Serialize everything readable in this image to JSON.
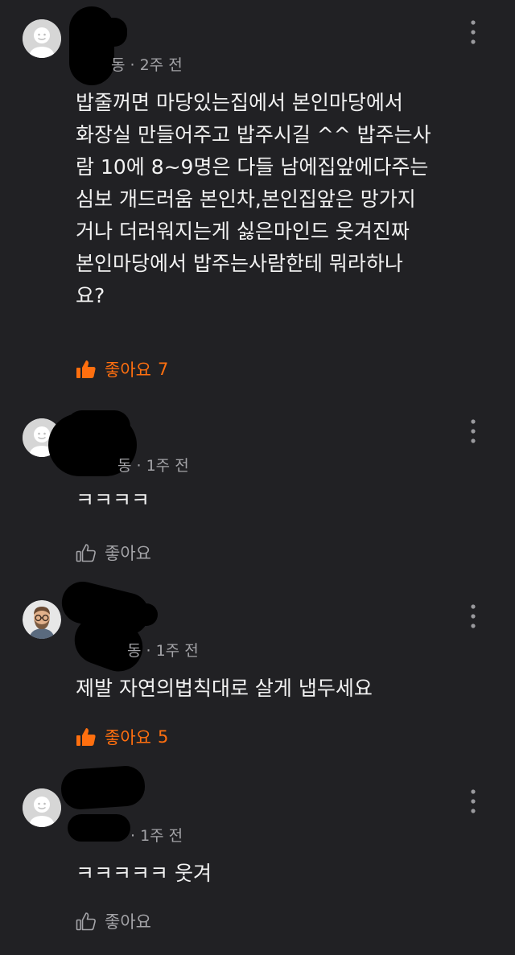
{
  "comments": [
    {
      "meta_tail": "동 · 2주 전",
      "text": "밥줄꺼면 마당있는집에서 본인마당에서\n화장실 만들어주고 밥주시길 ^^ 밥주는사\n람 10에 8~9명은 다들 남에집앞에다주는\n심보 개드러움 본인차,본인집앞은 망가지\n거나 더러워지는게 싫은마인드 웃겨진짜\n본인마당에서 밥주는사람한테 뭐라하나\n요?",
      "like_label": "좋아요",
      "like_count": "7"
    },
    {
      "meta_tail": "동 · 1주 전",
      "text": "ㅋㅋㅋㅋ",
      "like_label": "좋아요",
      "like_count": ""
    },
    {
      "meta_tail": "동 · 1주 전",
      "text": "제발 자연의법칙대로 살게 냅두세요",
      "like_label": "좋아요",
      "like_count": "5"
    },
    {
      "meta_tail": "· 1주 전",
      "text": "ㅋㅋㅋㅋㅋ 웃겨",
      "like_label": "좋아요",
      "like_count": ""
    }
  ],
  "colors": {
    "background": "#212124",
    "accent": "#ff6f0f",
    "meta": "#a4a4a8",
    "text": "#f2f2f2"
  },
  "icons": {
    "avatar_default": "person-placeholder-icon",
    "avatar_custom": "bearded-man-avatar-icon",
    "like": "thumbs-up-icon",
    "more": "more-vertical-icon"
  }
}
